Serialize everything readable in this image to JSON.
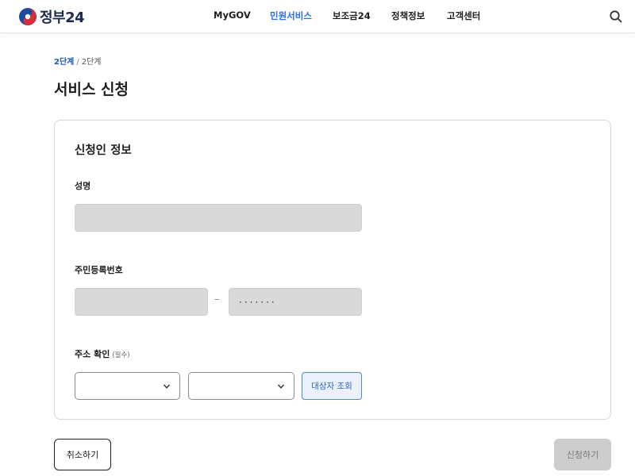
{
  "header": {
    "logo_text": "정부24",
    "nav": [
      {
        "label": "MyGOV",
        "active": false
      },
      {
        "label": "민원서비스",
        "active": true
      },
      {
        "label": "보조금24",
        "active": false
      },
      {
        "label": "정책정보",
        "active": false
      },
      {
        "label": "고객센터",
        "active": false
      }
    ],
    "search_icon": "search-icon"
  },
  "breadcrumb": {
    "step": "2단계",
    "separator": "/",
    "current": "2단계"
  },
  "page_title": "서비스 신청",
  "form": {
    "section_title": "신청인 정보",
    "name": {
      "label": "성명",
      "value": ""
    },
    "rrn": {
      "label": "주민등록번호",
      "front_value": "",
      "dash": "–",
      "back_value": "·······"
    },
    "address": {
      "label": "주소 확인",
      "required": "(필수)",
      "select1_value": "",
      "select2_value": "",
      "lookup_button": "대상자 조회"
    }
  },
  "actions": {
    "cancel_label": "취소하기",
    "apply_label": "신청하기"
  },
  "colors": {
    "accent": "#256ef4",
    "input_bg": "#d9d9d9",
    "disabled_btn": "#cdcdcd"
  }
}
